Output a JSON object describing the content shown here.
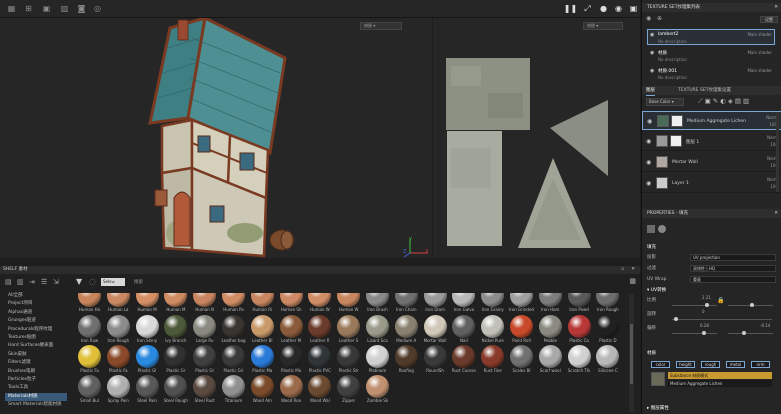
{
  "toolbar": {
    "left_icons": [
      "grid-icon",
      "grid-dense-icon",
      "grid-large-icon",
      "image-icon",
      "camera-icon",
      "target-icon"
    ],
    "right_icons": [
      "pause-icon",
      "expand-icon",
      "sphere-icon",
      "record-icon",
      "screenshot-icon"
    ]
  },
  "viewport3d": {
    "dropdown": "材质",
    "axis_labels": {
      "x": "X",
      "y": "Y",
      "z": "Z"
    }
  },
  "viewport2d": {
    "dropdown": "材质"
  },
  "shelf": {
    "title": "SHELF 素材",
    "search_placeholder": "Sele≠",
    "search_label": "搜索",
    "categories": [
      {
        "label": "All全部",
        "active": false
      },
      {
        "label": "Project项目",
        "active": false
      },
      {
        "label": "Alphas通道",
        "active": false
      },
      {
        "label": "Grunges脏迹",
        "active": false
      },
      {
        "label": "Procedurals程序纹理",
        "active": false
      },
      {
        "label": "Textures贴图",
        "active": false
      },
      {
        "label": "Hard Surfaces硬表面",
        "active": false
      },
      {
        "label": "Skin皮肤",
        "active": false
      },
      {
        "label": "Filters滤镜",
        "active": false
      },
      {
        "label": "Brushes笔刷",
        "active": false
      },
      {
        "label": "Particles粒子",
        "active": false
      },
      {
        "label": "Tools工具",
        "active": false
      },
      {
        "label": "Materials材质",
        "active": true
      },
      {
        "label": "Smart Materials智能材质",
        "active": false
      }
    ],
    "materials": [
      [
        {
          "label": "Human Ha",
          "color": "#c8845a"
        },
        {
          "label": "Human La",
          "color": "#c98a63"
        },
        {
          "label": "Human M",
          "color": "#d69066"
        },
        {
          "label": "Human M",
          "color": "#cf8b62"
        },
        {
          "label": "Human N",
          "color": "#c88560"
        },
        {
          "label": "Human Pa",
          "color": "#d08c64"
        },
        {
          "label": "Human Ri",
          "color": "#c78761"
        },
        {
          "label": "Human Sh",
          "color": "#cc8963"
        },
        {
          "label": "Human W",
          "color": "#d18d66"
        },
        {
          "label": "Human W",
          "color": "#c9875f"
        },
        {
          "label": "Iron Brush",
          "color": "#8a8a8a"
        },
        {
          "label": "Iron Chain",
          "color": "#707070"
        },
        {
          "label": "Iron Diam",
          "color": "#9a9a9a"
        },
        {
          "label": "Iron Galva",
          "color": "#b8b8b8"
        },
        {
          "label": "Iron Grainy",
          "color": "#8c8c8c"
        },
        {
          "label": "Iron Grinded",
          "color": "#a0a0a0"
        },
        {
          "label": "Iron Ham",
          "color": "#7c7c7c"
        },
        {
          "label": "Iron Powd",
          "color": "#5a5a5a"
        },
        {
          "label": "Iron Rough",
          "color": "#6e6e6e"
        }
      ],
      [
        {
          "label": "Iron Raw",
          "color": "#707070"
        },
        {
          "label": "Iron Rough",
          "color": "#8c8c8c"
        },
        {
          "label": "Iron Shiny",
          "color": "#d8d8d8"
        },
        {
          "label": "Ivy Branch",
          "color": "#4d5a3a"
        },
        {
          "label": "Large Ru",
          "color": "#8a8a80"
        },
        {
          "label": "Leather bag",
          "color": "#3a3530"
        },
        {
          "label": "Leather Bl",
          "color": "#c89a6a"
        },
        {
          "label": "Leather M",
          "color": "#8a5a3a"
        },
        {
          "label": "Leather R",
          "color": "#6a3a2a"
        },
        {
          "label": "Leather S",
          "color": "#9a7a5a"
        },
        {
          "label": "Lizard Sca",
          "color": "#9a9a8a"
        },
        {
          "label": "Medium A",
          "color": "#8a8070"
        },
        {
          "label": "Mortar Wall",
          "color": "#d0c8b8"
        },
        {
          "label": "Nail",
          "color": "#606060"
        },
        {
          "label": "Nickel Pure",
          "color": "#c0c0b8"
        },
        {
          "label": "Paint Roll",
          "color": "#c84a2a"
        },
        {
          "label": "Pebble",
          "color": "#8a8a80"
        },
        {
          "label": "Plastic Ca",
          "color": "#b83838"
        },
        {
          "label": "Plastic D",
          "color": "#202020"
        }
      ],
      [
        {
          "label": "Plastic Fa",
          "color": "#e0c038"
        },
        {
          "label": "Plastic Fa",
          "color": "#8a4a2a"
        },
        {
          "label": "Plastic Gl",
          "color": "#2a8ae0"
        },
        {
          "label": "Plastic Gr",
          "color": "#303030"
        },
        {
          "label": "Plastic Gr",
          "color": "#404040"
        },
        {
          "label": "Plastic Gri",
          "color": "#3a3a3a"
        },
        {
          "label": "Plastic Ma",
          "color": "#2a7ad8"
        },
        {
          "label": "Plastic Ma",
          "color": "#282828"
        },
        {
          "label": "Plastic PVC",
          "color": "#303538"
        },
        {
          "label": "Plastic Str",
          "color": "#383838"
        },
        {
          "label": "Platinum",
          "color": "#d0d0d0"
        },
        {
          "label": "Roofing",
          "color": "#503a2a"
        },
        {
          "label": "RoundSh",
          "color": "#3a3a3a"
        },
        {
          "label": "Rust Coarse",
          "color": "#6a3a2a"
        },
        {
          "label": "Rust Fine",
          "color": "#8a3a2a"
        },
        {
          "label": "Scales Bl",
          "color": "#707070"
        },
        {
          "label": "Scarf wool",
          "color": "#a8a8a8"
        },
        {
          "label": "Scratch Thi",
          "color": "#d0d0d0"
        },
        {
          "label": "Silicone C",
          "color": "#b8b8b8"
        },
        {
          "label": "Silver Pure",
          "color": "#c8c8c8"
        }
      ],
      [
        {
          "label": "Small Bul",
          "color": "#606060"
        },
        {
          "label": "Spray Pain",
          "color": "#b0b0b0"
        },
        {
          "label": "Steel Pain",
          "color": "#585858"
        },
        {
          "label": "Steel Rough",
          "color": "#505050"
        },
        {
          "label": "Steel Rust",
          "color": "#5a4a40"
        },
        {
          "label": "Titanium",
          "color": "#909090"
        },
        {
          "label": "Wood Am",
          "color": "#7a4a2a"
        },
        {
          "label": "Wood Roo",
          "color": "#9a6a4a"
        },
        {
          "label": "Wood Wal",
          "color": "#6a4a30"
        },
        {
          "label": "Zipper",
          "color": "#404040"
        },
        {
          "label": "Zombie Sk",
          "color": "#c09070"
        }
      ]
    ]
  },
  "texture_set_list": {
    "title": "TEXTURE SET纹理集列表",
    "settings_label": "设置",
    "items": [
      {
        "name": "lambert2",
        "shader": "Main shader",
        "desc": "No description",
        "active": true
      },
      {
        "name": "材质",
        "shader": "Main shader",
        "desc": "No description",
        "active": false
      },
      {
        "name": "材质.001",
        "shader": "Main shader",
        "desc": "No description",
        "active": false
      }
    ]
  },
  "layers": {
    "tab_layers": "图层",
    "tab_settings": "TEXTURE SET纹理集设置",
    "blend_mode": "Base Color",
    "items": [
      {
        "name": "Medium Aggregate Lichen",
        "blend": "Norm",
        "opacity": "100",
        "thumb": "#4a6a5a",
        "mask": true
      },
      {
        "name": "图层 1",
        "blend": "Norm",
        "opacity": "100",
        "thumb": "#9a9a9a",
        "mask": true
      },
      {
        "name": "Mortar Wall",
        "blend": "Norm",
        "opacity": "100",
        "thumb": "#b0a8a0",
        "mask": false
      },
      {
        "name": "Layer 1",
        "blend": "Norm",
        "opacity": "100",
        "thumb": "#cccccc",
        "mask": false
      }
    ]
  },
  "properties": {
    "title": "PROPERTIES - 填充",
    "section_fill": "填充",
    "projection_label": "投影",
    "projection_value": "UV projection",
    "filter_label": "过滤",
    "filter_value": "双线性 | HQ",
    "uvwrap_label": "UV Wrap",
    "uvwrap_value": "重复",
    "uv_transform_title": "UV转换",
    "scale_label": "比例",
    "scale_value": "2.21",
    "rotation_label": "旋转",
    "rotation_value": "0",
    "offset_label": "偏移",
    "offset_values": [
      "0.28",
      "-0.14"
    ],
    "material_title": "材质",
    "channels": [
      "color",
      "height",
      "rough",
      "metal",
      "nrm"
    ],
    "substance_title": "Substance 材质模式",
    "substance_name": "Medium Aggregate Lichen",
    "last_section": "图层属性"
  }
}
